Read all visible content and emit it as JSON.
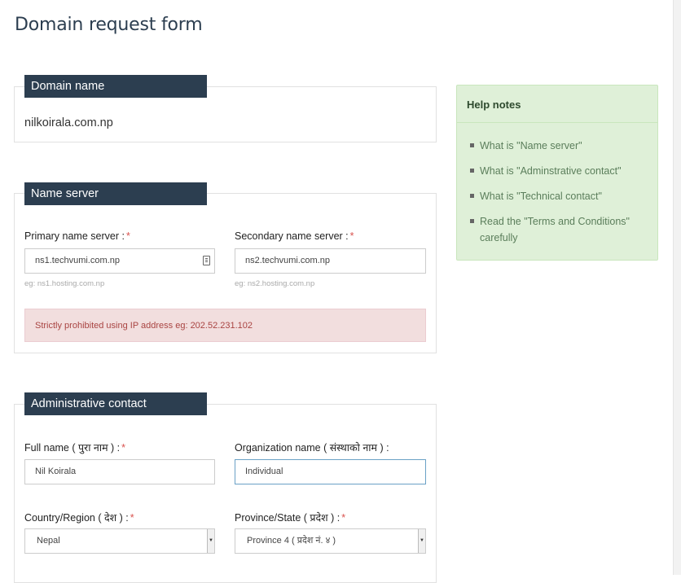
{
  "page": {
    "title": "Domain request form"
  },
  "domain_section": {
    "heading": "Domain name",
    "value": "nilkoirala.com.np"
  },
  "name_server_section": {
    "heading": "Name server",
    "primary": {
      "label": "Primary name server :",
      "required": "*",
      "value": "ns1.techvumi.com.np",
      "hint": "eg: ns1.hosting.com.np"
    },
    "secondary": {
      "label": "Secondary name server :",
      "required": "*",
      "value": "ns2.techvumi.com.np",
      "hint": "eg: ns2.hosting.com.np"
    },
    "alert": "Strictly prohibited using IP address eg: 202.52.231.102"
  },
  "admin_section": {
    "heading": "Administrative contact",
    "full_name": {
      "label": "Full name ( पुरा नाम ) :",
      "required": "*",
      "value": "Nil Koirala"
    },
    "organization": {
      "label": "Organization name ( संस्थाको नाम ) :",
      "value": "Individual"
    },
    "country": {
      "label": "Country/Region ( देश ) :",
      "required": "*",
      "selected": "Nepal"
    },
    "province": {
      "label": "Province/State ( प्रदेश ) :",
      "required": "*",
      "selected": "Province 4 ( प्रदेश नं. ४ )"
    }
  },
  "help": {
    "title": "Help notes",
    "items": [
      {
        "prefix": "What is ",
        "link": "\"Name server\"",
        "suffix": ""
      },
      {
        "prefix": "What is ",
        "link": "\"Adminstrative contact\"",
        "suffix": ""
      },
      {
        "prefix": "What is ",
        "link": "\"Technical contact\"",
        "suffix": ""
      },
      {
        "prefix": "Read the ",
        "link": "\"Terms and Conditions\"",
        "suffix": " carefully"
      }
    ]
  },
  "colors": {
    "section_tab": "#2c3e50",
    "help_bg": "#dff0d8",
    "alert_bg": "#f2dede",
    "alert_text": "#a94442",
    "required": "#d9534f"
  }
}
